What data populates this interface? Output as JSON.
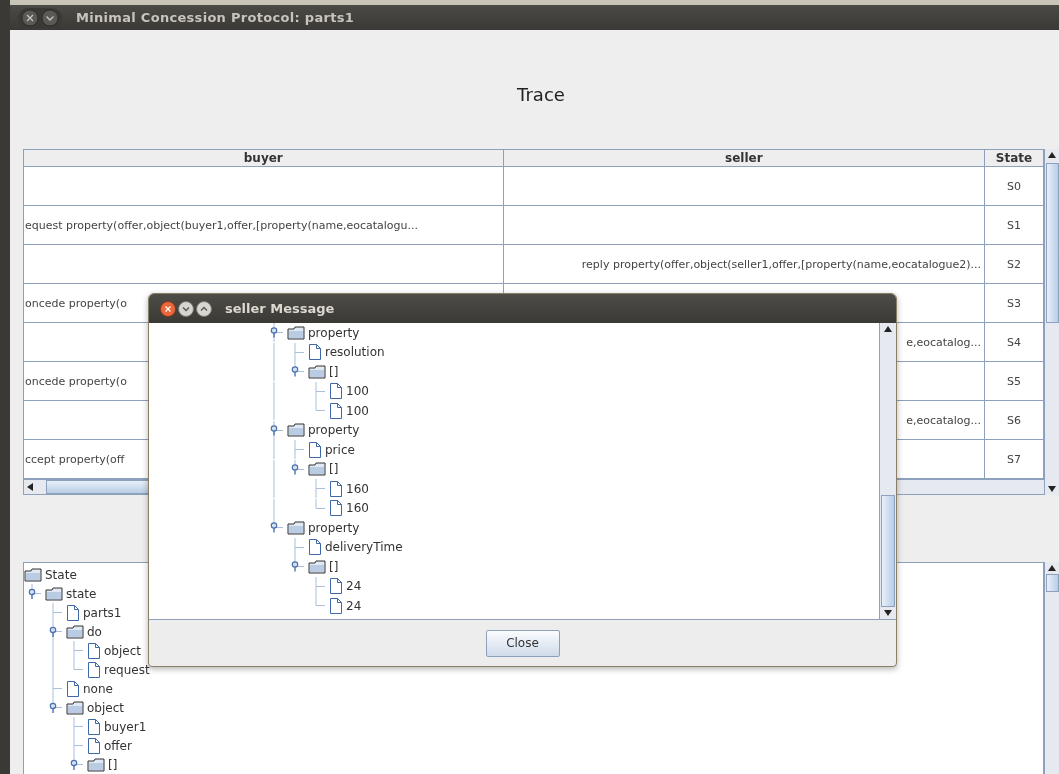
{
  "window": {
    "title": "Minimal Concession Protocol: parts1"
  },
  "heading": "Trace",
  "table": {
    "columns": [
      "buyer",
      "seller",
      "State"
    ],
    "rows": [
      {
        "buyer": "",
        "seller": "",
        "state": "S0"
      },
      {
        "buyer": "equest property(offer,object(buyer1,offer,[property(name,eocatalogu...",
        "seller": "",
        "state": "S1"
      },
      {
        "buyer": "",
        "seller": "reply property(offer,object(seller1,offer,[property(name,eocatalogue2)...",
        "state": "S2"
      },
      {
        "buyer": "oncede property(o",
        "seller": "",
        "state": "S3"
      },
      {
        "buyer": "",
        "seller": "e,eocatalog...",
        "state": "S4"
      },
      {
        "buyer": "oncede property(o",
        "seller": "",
        "state": "S5"
      },
      {
        "buyer": "",
        "seller": "e,eocatalog...",
        "state": "S6"
      },
      {
        "buyer": "ccept property(off",
        "seller": "",
        "state": "S7"
      }
    ]
  },
  "state_tree": [
    {
      "label": "State",
      "kind": "folder",
      "children": [
        {
          "label": "state",
          "kind": "folder",
          "expanded": true,
          "children": [
            {
              "label": "parts1",
              "kind": "leaf"
            },
            {
              "label": "do",
              "kind": "folder",
              "expanded": true,
              "children": [
                {
                  "label": "object",
                  "kind": "leaf"
                },
                {
                  "label": "request",
                  "kind": "leaf"
                }
              ]
            },
            {
              "label": "none",
              "kind": "leaf"
            },
            {
              "label": "object",
              "kind": "folder",
              "expanded": true,
              "children": [
                {
                  "label": "buyer1",
                  "kind": "leaf"
                },
                {
                  "label": "offer",
                  "kind": "leaf"
                },
                {
                  "label": "[]",
                  "kind": "folder",
                  "expanded": true
                }
              ]
            }
          ]
        }
      ]
    }
  ],
  "dialog": {
    "title": "seller Message",
    "tree": [
      {
        "label": "property",
        "kind": "folder",
        "expanded": true,
        "children": [
          {
            "label": "resolution",
            "kind": "leaf"
          },
          {
            "label": "[]",
            "kind": "folder",
            "expanded": true,
            "children": [
              {
                "label": "100",
                "kind": "leaf"
              },
              {
                "label": "100",
                "kind": "leaf"
              }
            ]
          }
        ]
      },
      {
        "label": "property",
        "kind": "folder",
        "expanded": true,
        "children": [
          {
            "label": "price",
            "kind": "leaf"
          },
          {
            "label": "[]",
            "kind": "folder",
            "expanded": true,
            "children": [
              {
                "label": "160",
                "kind": "leaf"
              },
              {
                "label": "160",
                "kind": "leaf"
              }
            ]
          }
        ]
      },
      {
        "label": "property",
        "kind": "folder",
        "expanded": true,
        "children": [
          {
            "label": "deliveryTime",
            "kind": "leaf"
          },
          {
            "label": "[]",
            "kind": "folder",
            "expanded": true,
            "children": [
              {
                "label": "24",
                "kind": "leaf"
              },
              {
                "label": "24",
                "kind": "leaf"
              }
            ]
          }
        ]
      }
    ],
    "button": "Close"
  }
}
